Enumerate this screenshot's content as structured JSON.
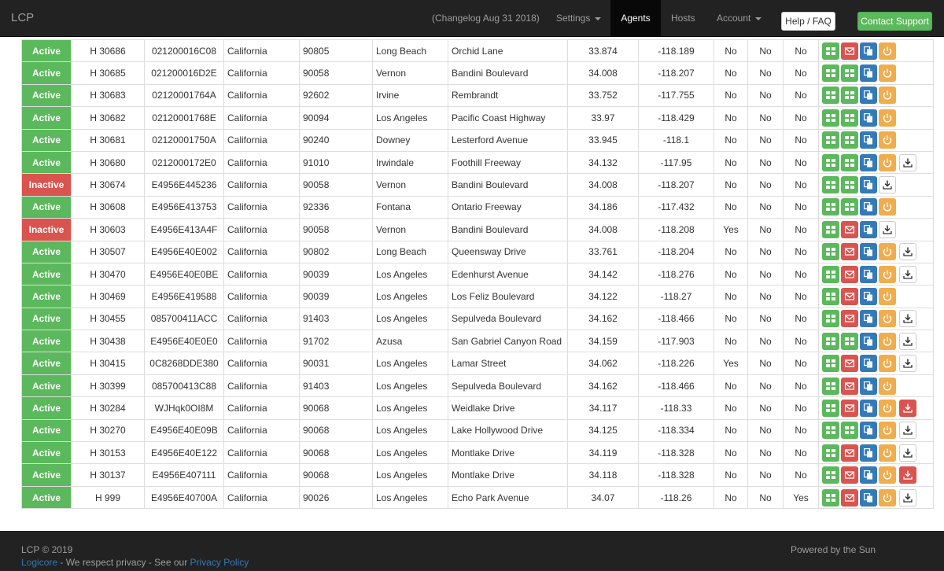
{
  "nav": {
    "brand": "LCP",
    "changelog": "(Changelog Aug 31 2018)",
    "settings": "Settings",
    "agents": "Agents",
    "hosts": "Hosts",
    "account": "Account",
    "help": "Help / FAQ",
    "contact": "Contact Support"
  },
  "rows": [
    {
      "status": "Active",
      "host": "H 30686",
      "id": "021200016C08",
      "state": "California",
      "zip": "90805",
      "city": "Long Beach",
      "street": "Orchid Lane",
      "lat": "33.874",
      "lon": "-118.189",
      "f1": "No",
      "f2": "No",
      "f3": "No",
      "actions": [
        "green",
        "red",
        "blue",
        "orange"
      ]
    },
    {
      "status": "Active",
      "host": "H 30685",
      "id": "021200016D2E",
      "state": "California",
      "zip": "90058",
      "city": "Vernon",
      "street": "Bandini Boulevard",
      "lat": "34.008",
      "lon": "-118.207",
      "f1": "No",
      "f2": "No",
      "f3": "No",
      "actions": [
        "green",
        "green",
        "blue",
        "orange"
      ]
    },
    {
      "status": "Active",
      "host": "H 30683",
      "id": "02120001764A",
      "state": "California",
      "zip": "92602",
      "city": "Irvine",
      "street": "Rembrandt",
      "lat": "33.752",
      "lon": "-117.755",
      "f1": "No",
      "f2": "No",
      "f3": "No",
      "actions": [
        "green",
        "green",
        "blue",
        "orange"
      ]
    },
    {
      "status": "Active",
      "host": "H 30682",
      "id": "02120001768E",
      "state": "California",
      "zip": "90094",
      "city": "Los Angeles",
      "street": "Pacific Coast Highway",
      "lat": "33.97",
      "lon": "-118.429",
      "f1": "No",
      "f2": "No",
      "f3": "No",
      "actions": [
        "green",
        "green",
        "blue",
        "orange"
      ]
    },
    {
      "status": "Active",
      "host": "H 30681",
      "id": "02120001750A",
      "state": "California",
      "zip": "90240",
      "city": "Downey",
      "street": "Lesterford Avenue",
      "lat": "33.945",
      "lon": "-118.1",
      "f1": "No",
      "f2": "No",
      "f3": "No",
      "actions": [
        "green",
        "green",
        "blue",
        "orange"
      ]
    },
    {
      "status": "Active",
      "host": "H 30680",
      "id": "0212000172E0",
      "state": "California",
      "zip": "91010",
      "city": "Irwindale",
      "street": "Foothill Freeway",
      "lat": "34.132",
      "lon": "-117.95",
      "f1": "No",
      "f2": "No",
      "f3": "No",
      "actions": [
        "green",
        "green",
        "blue",
        "orange",
        "download"
      ]
    },
    {
      "status": "Inactive",
      "host": "H 30674",
      "id": "E4956E445236",
      "state": "California",
      "zip": "90058",
      "city": "Vernon",
      "street": "Bandini Boulevard",
      "lat": "34.008",
      "lon": "-118.207",
      "f1": "No",
      "f2": "No",
      "f3": "No",
      "actions": [
        "green",
        "green",
        "blue",
        "download"
      ]
    },
    {
      "status": "Active",
      "host": "H 30608",
      "id": "E4956E413753",
      "state": "California",
      "zip": "92336",
      "city": "Fontana",
      "street": "Ontario Freeway",
      "lat": "34.186",
      "lon": "-117.432",
      "f1": "No",
      "f2": "No",
      "f3": "No",
      "actions": [
        "green",
        "green",
        "blue",
        "orange"
      ]
    },
    {
      "status": "Inactive",
      "host": "H 30603",
      "id": "E4956E413A4F",
      "state": "California",
      "zip": "90058",
      "city": "Vernon",
      "street": "Bandini Boulevard",
      "lat": "34.008",
      "lon": "-118.208",
      "f1": "Yes",
      "f2": "No",
      "f3": "No",
      "actions": [
        "green",
        "red",
        "blue",
        "download"
      ]
    },
    {
      "status": "Active",
      "host": "H 30507",
      "id": "E4956E40E002",
      "state": "California",
      "zip": "90802",
      "city": "Long Beach",
      "street": "Queensway Drive",
      "lat": "33.761",
      "lon": "-118.204",
      "f1": "No",
      "f2": "No",
      "f3": "No",
      "actions": [
        "green",
        "red",
        "blue",
        "orange",
        "download"
      ]
    },
    {
      "status": "Active",
      "host": "H 30470",
      "id": "E4956E40E0BE",
      "state": "California",
      "zip": "90039",
      "city": "Los Angeles",
      "street": "Edenhurst Avenue",
      "lat": "34.142",
      "lon": "-118.276",
      "f1": "No",
      "f2": "No",
      "f3": "No",
      "actions": [
        "green",
        "red",
        "blue",
        "orange",
        "download"
      ]
    },
    {
      "status": "Active",
      "host": "H 30469",
      "id": "E4956E419588",
      "state": "California",
      "zip": "90039",
      "city": "Los Angeles",
      "street": "Los Feliz Boulevard",
      "lat": "34.122",
      "lon": "-118.27",
      "f1": "No",
      "f2": "No",
      "f3": "No",
      "actions": [
        "green",
        "red",
        "blue",
        "orange"
      ]
    },
    {
      "status": "Active",
      "host": "H 30455",
      "id": "085700411ACC",
      "state": "California",
      "zip": "91403",
      "city": "Los Angeles",
      "street": "Sepulveda Boulevard",
      "lat": "34.162",
      "lon": "-118.466",
      "f1": "No",
      "f2": "No",
      "f3": "No",
      "actions": [
        "green",
        "red",
        "blue",
        "orange",
        "download"
      ]
    },
    {
      "status": "Active",
      "host": "H 30438",
      "id": "E4956E40E0E0",
      "state": "California",
      "zip": "91702",
      "city": "Azusa",
      "street": "San Gabriel Canyon Road",
      "lat": "34.159",
      "lon": "-117.903",
      "f1": "No",
      "f2": "No",
      "f3": "No",
      "actions": [
        "green",
        "green",
        "blue",
        "orange",
        "download"
      ]
    },
    {
      "status": "Active",
      "host": "H 30415",
      "id": "0C8268DDE380",
      "state": "California",
      "zip": "90031",
      "city": "Los Angeles",
      "street": "Lamar Street",
      "lat": "34.062",
      "lon": "-118.226",
      "f1": "Yes",
      "f2": "No",
      "f3": "No",
      "actions": [
        "green",
        "red",
        "blue",
        "orange",
        "download"
      ]
    },
    {
      "status": "Active",
      "host": "H 30399",
      "id": "085700413C88",
      "state": "California",
      "zip": "91403",
      "city": "Los Angeles",
      "street": "Sepulveda Boulevard",
      "lat": "34.162",
      "lon": "-118.466",
      "f1": "No",
      "f2": "No",
      "f3": "No",
      "actions": [
        "green",
        "red",
        "blue",
        "orange"
      ]
    },
    {
      "status": "Active",
      "host": "H 30284",
      "id": "WJHqk0OI8M",
      "state": "California",
      "zip": "90068",
      "city": "Los Angeles",
      "street": "Weidlake Drive",
      "lat": "34.117",
      "lon": "-118.33",
      "f1": "No",
      "f2": "No",
      "f3": "No",
      "actions": [
        "green",
        "red",
        "blue",
        "orange",
        "download-red"
      ]
    },
    {
      "status": "Active",
      "host": "H 30270",
      "id": "E4956E40E09B",
      "state": "California",
      "zip": "90068",
      "city": "Los Angeles",
      "street": "Lake Hollywood Drive",
      "lat": "34.125",
      "lon": "-118.334",
      "f1": "No",
      "f2": "No",
      "f3": "No",
      "actions": [
        "green",
        "green",
        "blue",
        "orange",
        "download"
      ]
    },
    {
      "status": "Active",
      "host": "H 30153",
      "id": "E4956E40E122",
      "state": "California",
      "zip": "90068",
      "city": "Los Angeles",
      "street": "Montlake Drive",
      "lat": "34.119",
      "lon": "-118.328",
      "f1": "No",
      "f2": "No",
      "f3": "No",
      "actions": [
        "green",
        "red",
        "blue",
        "orange",
        "download"
      ]
    },
    {
      "status": "Active",
      "host": "H 30137",
      "id": "E4956E407111",
      "state": "California",
      "zip": "90068",
      "city": "Los Angeles",
      "street": "Montlake Drive",
      "lat": "34.118",
      "lon": "-118.328",
      "f1": "No",
      "f2": "No",
      "f3": "No",
      "actions": [
        "green",
        "red",
        "blue",
        "orange",
        "download-red"
      ]
    },
    {
      "status": "Active",
      "host": "H 999",
      "id": "E4956E40700A",
      "state": "California",
      "zip": "90026",
      "city": "Los Angeles",
      "street": "Echo Park Avenue",
      "lat": "34.07",
      "lon": "-118.26",
      "f1": "No",
      "f2": "No",
      "f3": "Yes",
      "actions": [
        "green",
        "red",
        "blue",
        "orange",
        "download"
      ]
    }
  ],
  "footer": {
    "copyright": "LCP © 2019",
    "company": "Logicore",
    "privacy_text": " - We respect privacy - See our ",
    "privacy_link": "Privacy Policy",
    "powered": "Powered by the Sun"
  },
  "colors": {
    "navbar": "#222222",
    "success": "#5cb85c",
    "danger": "#d9534f",
    "primary": "#337ab7",
    "warning": "#f0ad4e"
  }
}
